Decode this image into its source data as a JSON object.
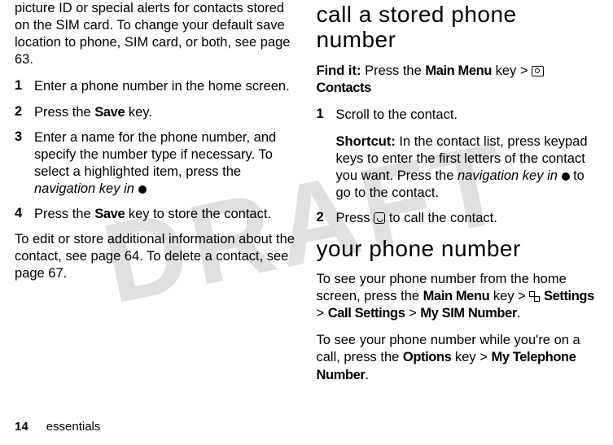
{
  "watermark": "DRAFT",
  "left": {
    "intro": "picture ID or special alerts for contacts stored on the SIM card. To change your default save location to phone, SIM card, or both, see page 63.",
    "steps": [
      {
        "n": "1",
        "t_a": "Enter a phone number in the home screen."
      },
      {
        "n": "2",
        "t_a": "Press the ",
        "t_key": "Save",
        "t_b": " key."
      },
      {
        "n": "3",
        "t_a": "Enter a name for the phone number, and specify the number type if necessary. To select a highlighted item, press the ",
        "t_it": "navigation key in",
        "t_b": " "
      },
      {
        "n": "4",
        "t_a": "Press the ",
        "t_key": "Save",
        "t_b": " key to store the contact."
      }
    ],
    "outro": "To edit or store additional information about the contact, see page 64. To delete a contact, see page 67."
  },
  "right": {
    "h1": "call a stored phone number",
    "findit_label": "Find it:",
    "findit_a": " Press the ",
    "findit_key": "Main Menu",
    "findit_b": " key > ",
    "findit_contacts": "Contacts",
    "steps": [
      {
        "n": "1",
        "line1": "Scroll to the contact.",
        "sc_label": "Shortcut:",
        "sc_a": " In the contact list, press keypad keys to enter the first letters of the contact you want. Press the ",
        "sc_it": "navigation key in",
        "sc_b": " to go to the contact."
      },
      {
        "n": "2",
        "t_a": "Press ",
        "t_b": " to call the contact."
      }
    ],
    "h2": "your phone number",
    "p2_a": "To see your phone number from the home screen, press the ",
    "p2_key": "Main Menu",
    "p2_b": " key > ",
    "p2_settings": "Settings",
    "p2_gt1": " > ",
    "p2_call": "Call Settings",
    "p2_gt2": " > ",
    "p2_sim": "My SIM Number",
    "p2_dot": ".",
    "p3_a": "To see your phone number while you're on a call, press the ",
    "p3_key": "Options",
    "p3_b": " key > ",
    "p3_tel": "My Telephone Number",
    "p3_dot": "."
  },
  "footer": {
    "page": "14",
    "section": "essentials"
  }
}
